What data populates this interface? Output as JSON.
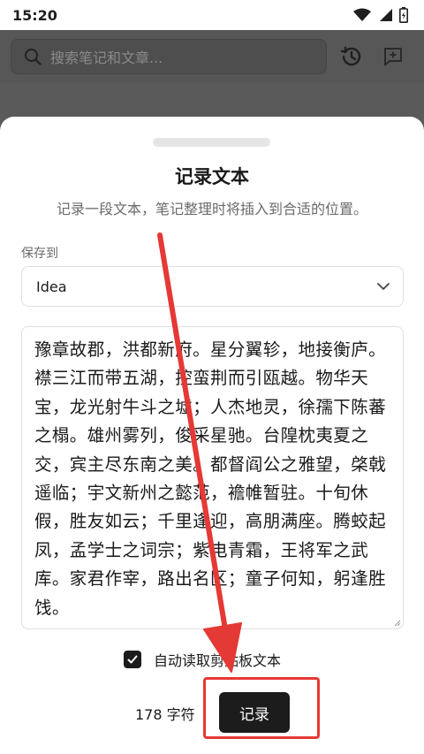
{
  "status_bar": {
    "time": "15:20",
    "icons": [
      "wifi-icon",
      "signal-icon",
      "battery-icon"
    ]
  },
  "app_bar": {
    "search_placeholder": "搜索笔记和文章...",
    "icons": [
      "search-icon",
      "history-icon",
      "chat-add-icon"
    ]
  },
  "sheet": {
    "title": "记录文本",
    "subtitle": "记录一段文本，笔记整理时将插入到合适的位置。",
    "save_to_label": "保存到",
    "save_to_value": "Idea",
    "text_content": "豫章故郡，洪都新府。星分翼轸，地接衡庐。襟三江而带五湖，控蛮荆而引瓯越。物华天宝，龙光射牛斗之墟；人杰地灵，徐孺下陈蕃之榻。雄州雾列，俊采星驰。台隍枕夷夏之交，宾主尽东南之美。都督阎公之雅望，棨戟遥临；宇文新州之懿范，襜帷暂驻。十旬休假，胜友如云；千里逢迎，高朋满座。腾蛟起凤，孟学士之词宗；紫电青霜，王将军之武库。家君作宰，路出名区；童子何知，躬逢胜饯。",
    "auto_read_label": "自动读取剪贴板文本",
    "auto_read_checked": true,
    "char_count": "178 字符",
    "record_button": "记录"
  },
  "colors": {
    "accent": "#1c1c1c",
    "annotation": "#e53935",
    "overlay": "#575757"
  }
}
